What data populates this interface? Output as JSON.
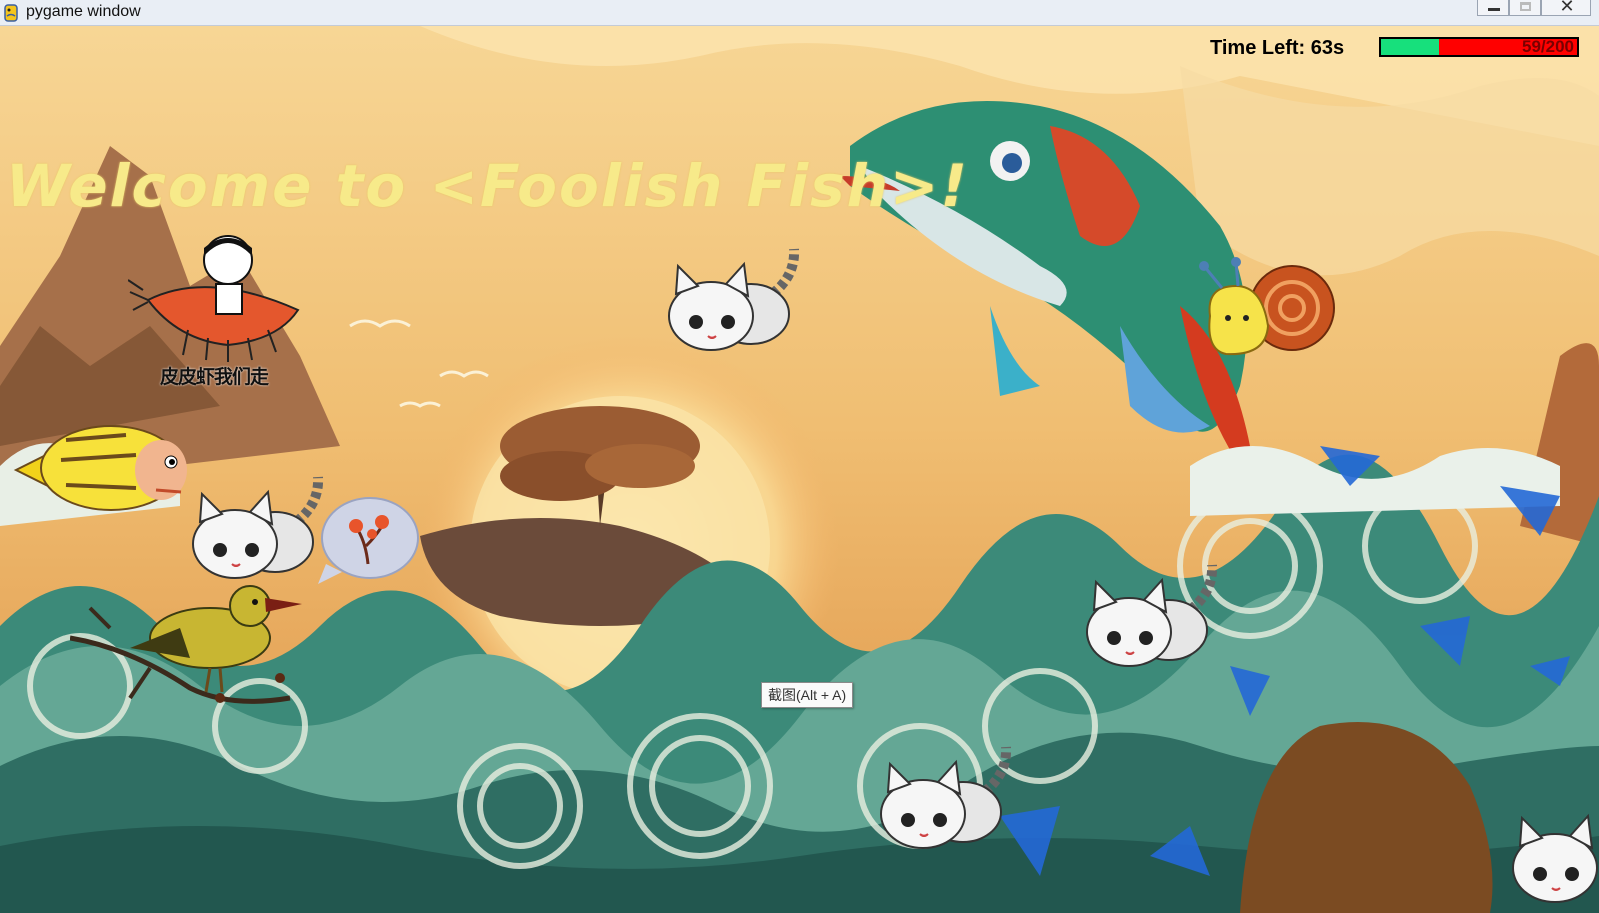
{
  "window": {
    "title": "pygame window",
    "icon": "python-snake-icon",
    "controls": {
      "minimize": "minimize-icon",
      "maximize": "maximize-icon",
      "close": "close-icon",
      "close_glyph": "✕"
    }
  },
  "hud": {
    "time_left": "Time Left: 63s",
    "health_text": "59/200",
    "health_fraction": 0.295,
    "health_colors": {
      "filled": "#17e07c",
      "empty": "#ff0000",
      "border": "#000000"
    }
  },
  "banner": {
    "welcome": "Welcome to <Foolish Fish>!"
  },
  "sprites": {
    "player_fish": "yellow-striped-fish",
    "shrimp_label": "皮皮虾我们走",
    "enemies": [
      "kitten",
      "kitten",
      "kitten",
      "kitten",
      "kitten",
      "snail",
      "bird",
      "bubble-flower"
    ]
  },
  "tooltip": {
    "text": "截图(Alt + A)"
  },
  "colors": {
    "welcome_text": "#f7ea8a",
    "sky": "#f2c47a",
    "wave": "#2f7d6d"
  }
}
